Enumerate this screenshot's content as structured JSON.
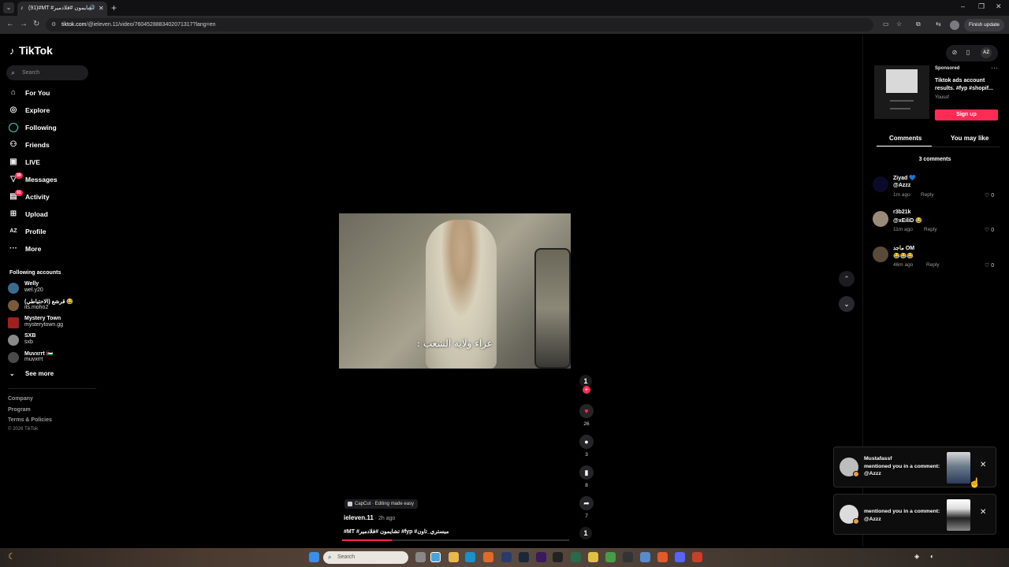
{
  "browser": {
    "tab_title": "(91)#MT #تشايمون #فلادمير",
    "new_tab": "+",
    "url_host": "tiktok.com",
    "url_path": "/@ieleven.11/video/7604528883402071317?lang=en",
    "finish_update": "Finish update",
    "window_controls": [
      "–",
      "❐",
      "✕"
    ]
  },
  "sidebar": {
    "logo": "TikTok",
    "search_placeholder": "Search",
    "nav": [
      {
        "label": "For You",
        "icon": "home-icon"
      },
      {
        "label": "Explore",
        "icon": "compass-icon"
      },
      {
        "label": "Following",
        "icon": "following-icon"
      },
      {
        "label": "Friends",
        "icon": "friends-icon"
      },
      {
        "label": "LIVE",
        "icon": "live-icon"
      },
      {
        "label": "Messages",
        "icon": "messages-icon",
        "badge": "99"
      },
      {
        "label": "Activity",
        "icon": "activity-icon",
        "badge": "91"
      },
      {
        "label": "Upload",
        "icon": "upload-icon"
      },
      {
        "label": "Profile",
        "icon": "profile-icon"
      },
      {
        "label": "More",
        "icon": "more-icon"
      }
    ],
    "following_title": "Following accounts",
    "accounts": [
      {
        "name": "Welly",
        "handle": "wel.y20",
        "color": "#3d6b8f"
      },
      {
        "name": "(الاحتياطي) قرشع 😂",
        "handle": "its.moho2",
        "color": "#7a5a3a"
      },
      {
        "name": "Mystery Town",
        "handle": "mysterytown.gg",
        "color": "#a02020"
      },
      {
        "name": "SXB",
        "handle": "sxb",
        "color": "#8a8a8a"
      },
      {
        "name": "Muvxrrt 🇵🇸",
        "handle": "muvxrrt",
        "color": "#4a4a4a"
      }
    ],
    "see_more": "See more",
    "footer": [
      "Company",
      "Program",
      "Terms & Policies"
    ],
    "copyright": "© 2026 TikTok"
  },
  "video": {
    "caption": "عزاء ولاية الشعب :",
    "capcut": "CapCut · Editing made easy",
    "author": "ieleven.11",
    "posted": " · 2h ago",
    "description": "#MT #تشايمون #فلادمير #fyp #ميستري_تاون",
    "progress": 0.22,
    "likes": "26",
    "comments": "3",
    "saves": "8",
    "shares": "7"
  },
  "ad": {
    "sponsored": "Sponsored",
    "title": "Tiktok ads account results. #fyp #shopif...",
    "by": "Youssf",
    "cta": "Sign up"
  },
  "panel": {
    "tab_comments": "Comments",
    "tab_may_like": "You may like",
    "comment_count": "3 comments",
    "comments": [
      {
        "name": "Ziyad 💙",
        "text": "@Azzz",
        "time": "1m ago",
        "reply": "Reply",
        "likes": "0",
        "avatar": "#0a0a2a"
      },
      {
        "name": "r3b21k",
        "text": "@xEiliD 😂",
        "time": "11m ago",
        "reply": "Reply",
        "likes": "0",
        "avatar": "#9a8a7a"
      },
      {
        "name": "ماجد OM",
        "text": "😂😂😂",
        "time": "46m ago",
        "reply": "Reply",
        "likes": "0",
        "avatar": "#5a4a3a"
      }
    ]
  },
  "notifications": [
    {
      "name": "Mustafassf",
      "text": "mentioned you in a comment: @Azzz"
    },
    {
      "name": "",
      "text": "mentioned you in a comment: @Azzz"
    }
  ],
  "taskbar": {
    "search_placeholder": "Search"
  }
}
